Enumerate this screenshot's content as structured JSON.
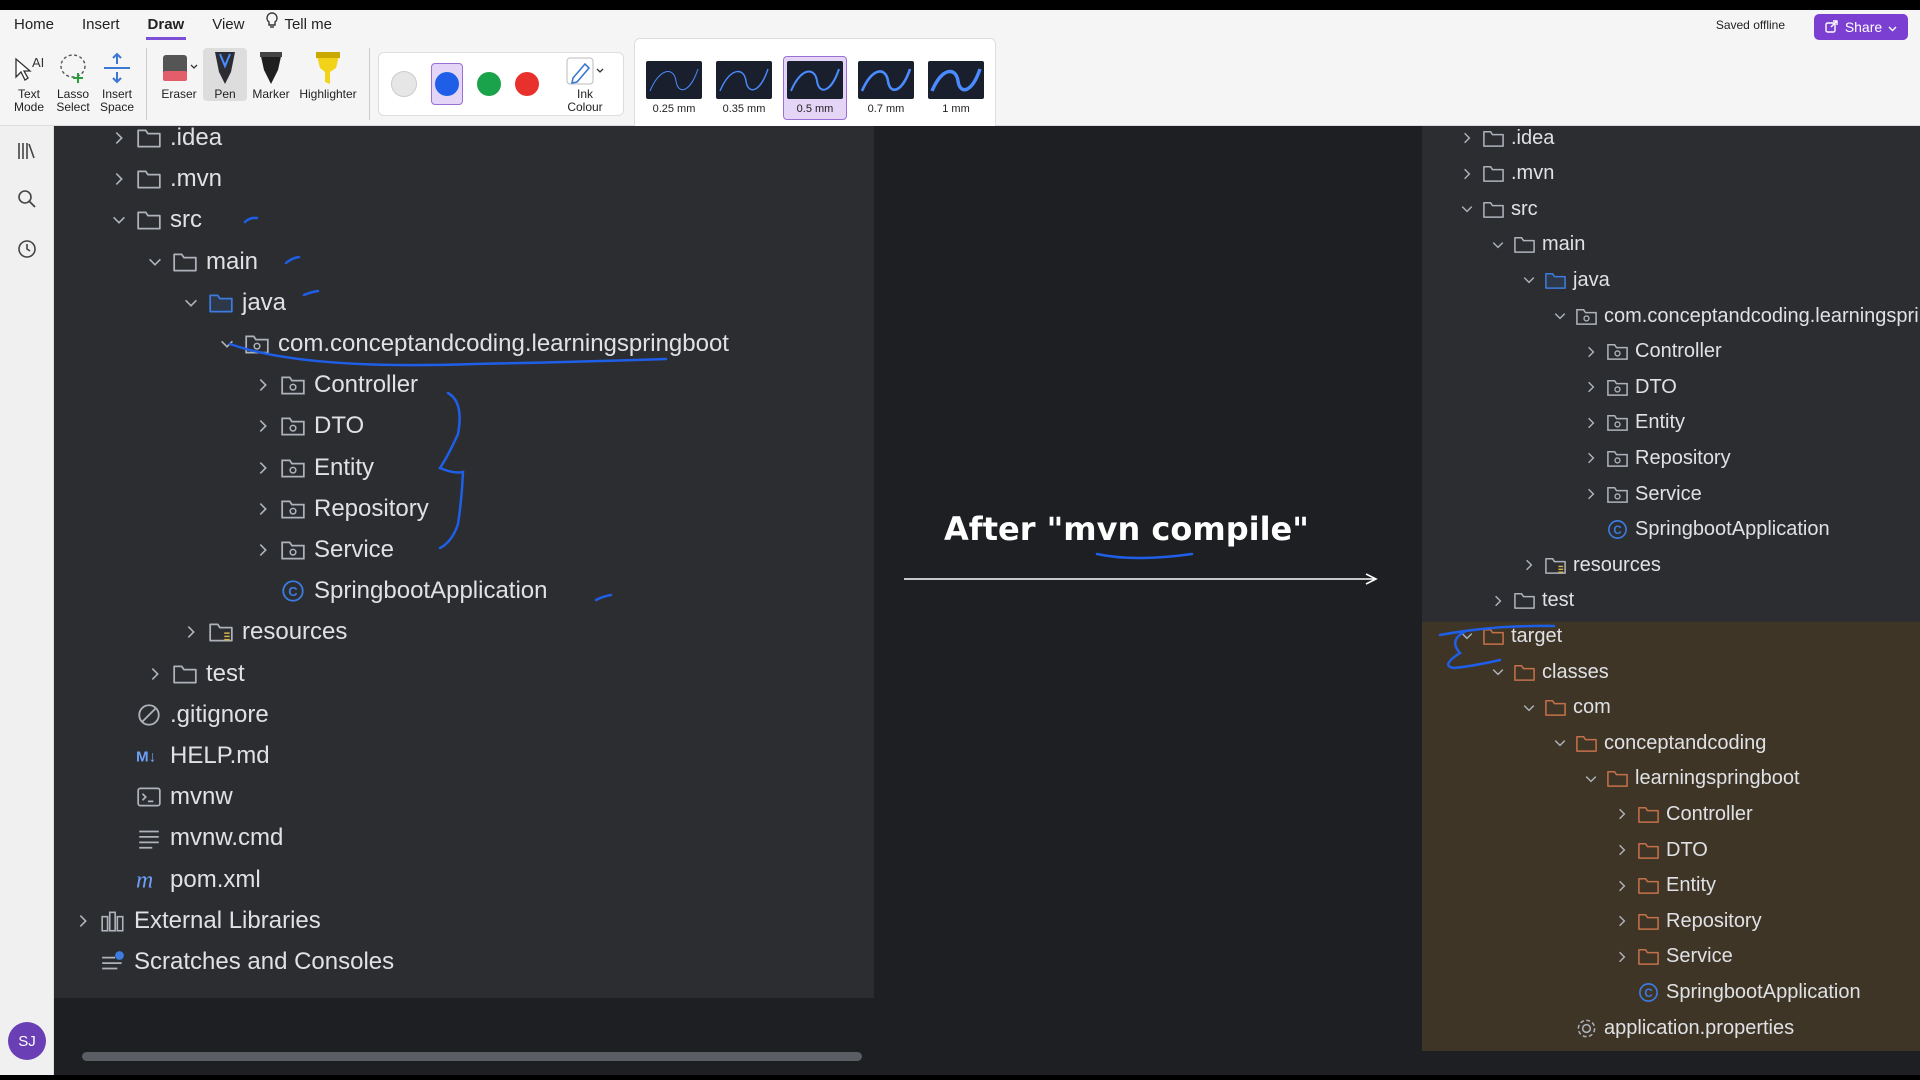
{
  "ribbon": {
    "tabs": [
      "Home",
      "Insert",
      "Draw",
      "View",
      "Tell me"
    ],
    "saved_status": "Saved offline",
    "share_label": "Share",
    "tools": {
      "text_mode": "Text Mode",
      "lasso_select": "Lasso Select",
      "insert_space": "Insert Space",
      "eraser": "Eraser",
      "pen": "Pen",
      "marker": "Marker",
      "highlighter": "Highlighter",
      "ink_colour": "Ink Colour"
    },
    "colors": [
      "#e6e6e6",
      "#1f5fe8",
      "#1aa34a",
      "#e8312c"
    ],
    "selected_color": "#1f5fe8",
    "sizes": [
      "0.25 mm",
      "0.35 mm",
      "0.5 mm",
      "0.7 mm",
      "1 mm"
    ],
    "selected_size": "0.5 mm"
  },
  "user": {
    "initials": "SJ"
  },
  "left_tree": [
    {
      "label": ".idea",
      "type": "folder",
      "expanded": false
    },
    {
      "label": ".mvn",
      "type": "folder",
      "expanded": false
    },
    {
      "label": "src",
      "type": "folder",
      "expanded": true
    },
    {
      "label": "main",
      "type": "folder",
      "expanded": true
    },
    {
      "label": "java",
      "type": "source-folder",
      "expanded": true
    },
    {
      "label": "com.conceptandcoding.learningspringboot",
      "type": "package",
      "expanded": true
    },
    {
      "label": "Controller",
      "type": "package",
      "expanded": false
    },
    {
      "label": "DTO",
      "type": "package",
      "expanded": false
    },
    {
      "label": "Entity",
      "type": "package",
      "expanded": false
    },
    {
      "label": "Repository",
      "type": "package",
      "expanded": false
    },
    {
      "label": "Service",
      "type": "package",
      "expanded": false
    },
    {
      "label": "SpringbootApplication",
      "type": "class"
    },
    {
      "label": "resources",
      "type": "resources-folder",
      "expanded": false
    },
    {
      "label": "test",
      "type": "folder",
      "expanded": false
    },
    {
      "label": ".gitignore",
      "type": "gitignore"
    },
    {
      "label": "HELP.md",
      "type": "markdown"
    },
    {
      "label": "mvnw",
      "type": "shell"
    },
    {
      "label": "mvnw.cmd",
      "type": "text"
    },
    {
      "label": "pom.xml",
      "type": "maven"
    },
    {
      "label": "External Libraries",
      "type": "libraries",
      "expanded": false
    },
    {
      "label": "Scratches and Consoles",
      "type": "scratches"
    }
  ],
  "caption": "After \"mvn compile\"",
  "right_tree": [
    {
      "label": ".idea",
      "type": "folder",
      "expanded": false
    },
    {
      "label": ".mvn",
      "type": "folder",
      "expanded": false
    },
    {
      "label": "src",
      "type": "folder",
      "expanded": true
    },
    {
      "label": "main",
      "type": "folder",
      "expanded": true
    },
    {
      "label": "java",
      "type": "source-folder",
      "expanded": true
    },
    {
      "label": "com.conceptandcoding.learningspringboot",
      "type": "package",
      "expanded": true
    },
    {
      "label": "Controller",
      "type": "package",
      "expanded": false
    },
    {
      "label": "DTO",
      "type": "package",
      "expanded": false
    },
    {
      "label": "Entity",
      "type": "package",
      "expanded": false
    },
    {
      "label": "Repository",
      "type": "package",
      "expanded": false
    },
    {
      "label": "Service",
      "type": "package",
      "expanded": false
    },
    {
      "label": "SpringbootApplication",
      "type": "class"
    },
    {
      "label": "resources",
      "type": "resources-folder",
      "expanded": false
    },
    {
      "label": "test",
      "type": "folder",
      "expanded": false
    },
    {
      "label": "target",
      "type": "excluded-folder",
      "expanded": true
    },
    {
      "label": "classes",
      "type": "excluded-folder",
      "expanded": true
    },
    {
      "label": "com",
      "type": "excluded-folder",
      "expanded": true
    },
    {
      "label": "conceptandcoding",
      "type": "excluded-folder",
      "expanded": true
    },
    {
      "label": "learningspringboot",
      "type": "excluded-folder",
      "expanded": true
    },
    {
      "label": "Controller",
      "type": "excluded-folder",
      "expanded": false
    },
    {
      "label": "DTO",
      "type": "excluded-folder",
      "expanded": false
    },
    {
      "label": "Entity",
      "type": "excluded-folder",
      "expanded": false
    },
    {
      "label": "Repository",
      "type": "excluded-folder",
      "expanded": false
    },
    {
      "label": "Service",
      "type": "excluded-folder",
      "expanded": false
    },
    {
      "label": "SpringbootApplication",
      "type": "class"
    },
    {
      "label": "application.properties",
      "type": "properties"
    }
  ],
  "ink_color": "#1f5fe8"
}
